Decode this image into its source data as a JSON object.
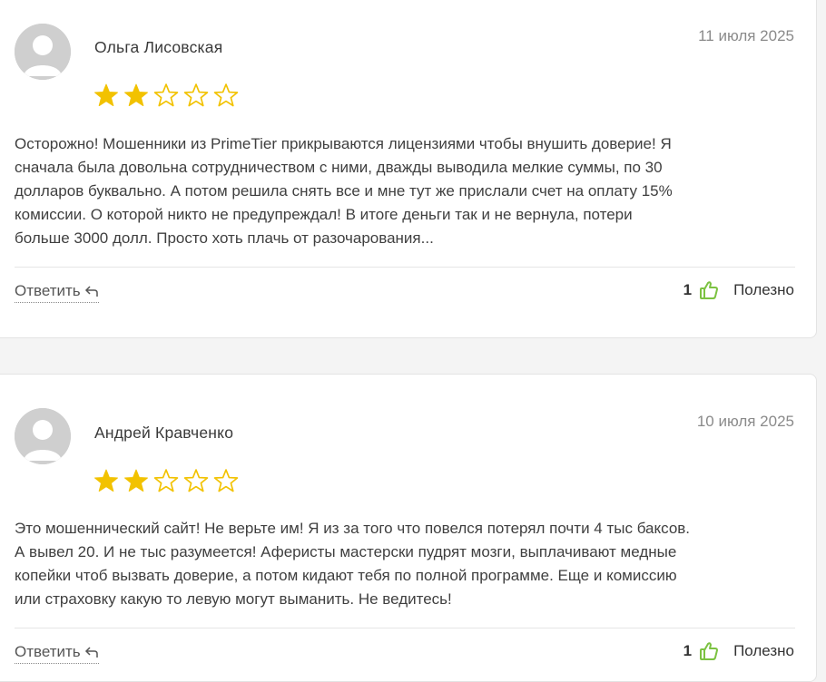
{
  "colors": {
    "star_filled": "#f2c200",
    "star_empty_outline": "#f2c200",
    "thumb_icon": "#7cc242",
    "avatar_bg": "#cfcfcf"
  },
  "reviews": [
    {
      "author": "Ольга Лисовская",
      "date": "11 июля 2025",
      "rating": 2,
      "max_rating": 5,
      "text_lines": [
        "Осторожно! Мошенники из PrimeTier прикрываются лицензиями чтобы внушить доверие! Я",
        "сначала была довольна сотрудничеством с ними, дважды выводила мелкие суммы, по 30",
        "долларов буквально. А потом решила снять все и мне тут же прислали счет на оплату 15%",
        "комиссии. О которой никто не предупреждал! В итоге деньги так и не вернула, потери",
        "больше 3000 долл. Просто хоть плачь от разочарования..."
      ],
      "reply_label": "Ответить",
      "helpful_count": "1",
      "helpful_label": "Полезно"
    },
    {
      "author": "Андрей Кравченко",
      "date": "10 июля 2025",
      "rating": 2,
      "max_rating": 5,
      "text_lines": [
        "Это мошеннический сайт! Не верьте им! Я из за того что повелся потерял почти 4 тыс баксов.",
        "А вывел 20. И не тыс разумеется! Аферисты мастерски пудрят мозги, выплачивают медные",
        "копейки чтоб вызвать доверие, а потом кидают тебя по полной программе. Еще и комиссию",
        "или страховку какую то левую могут выманить. Не ведитесь!"
      ],
      "reply_label": "Ответить",
      "helpful_count": "1",
      "helpful_label": "Полезно"
    }
  ],
  "icons": {
    "avatar": "user-placeholder-icon",
    "star": "star-icon",
    "reply": "reply-arrow-icon",
    "helpful": "thumbs-up-icon"
  }
}
